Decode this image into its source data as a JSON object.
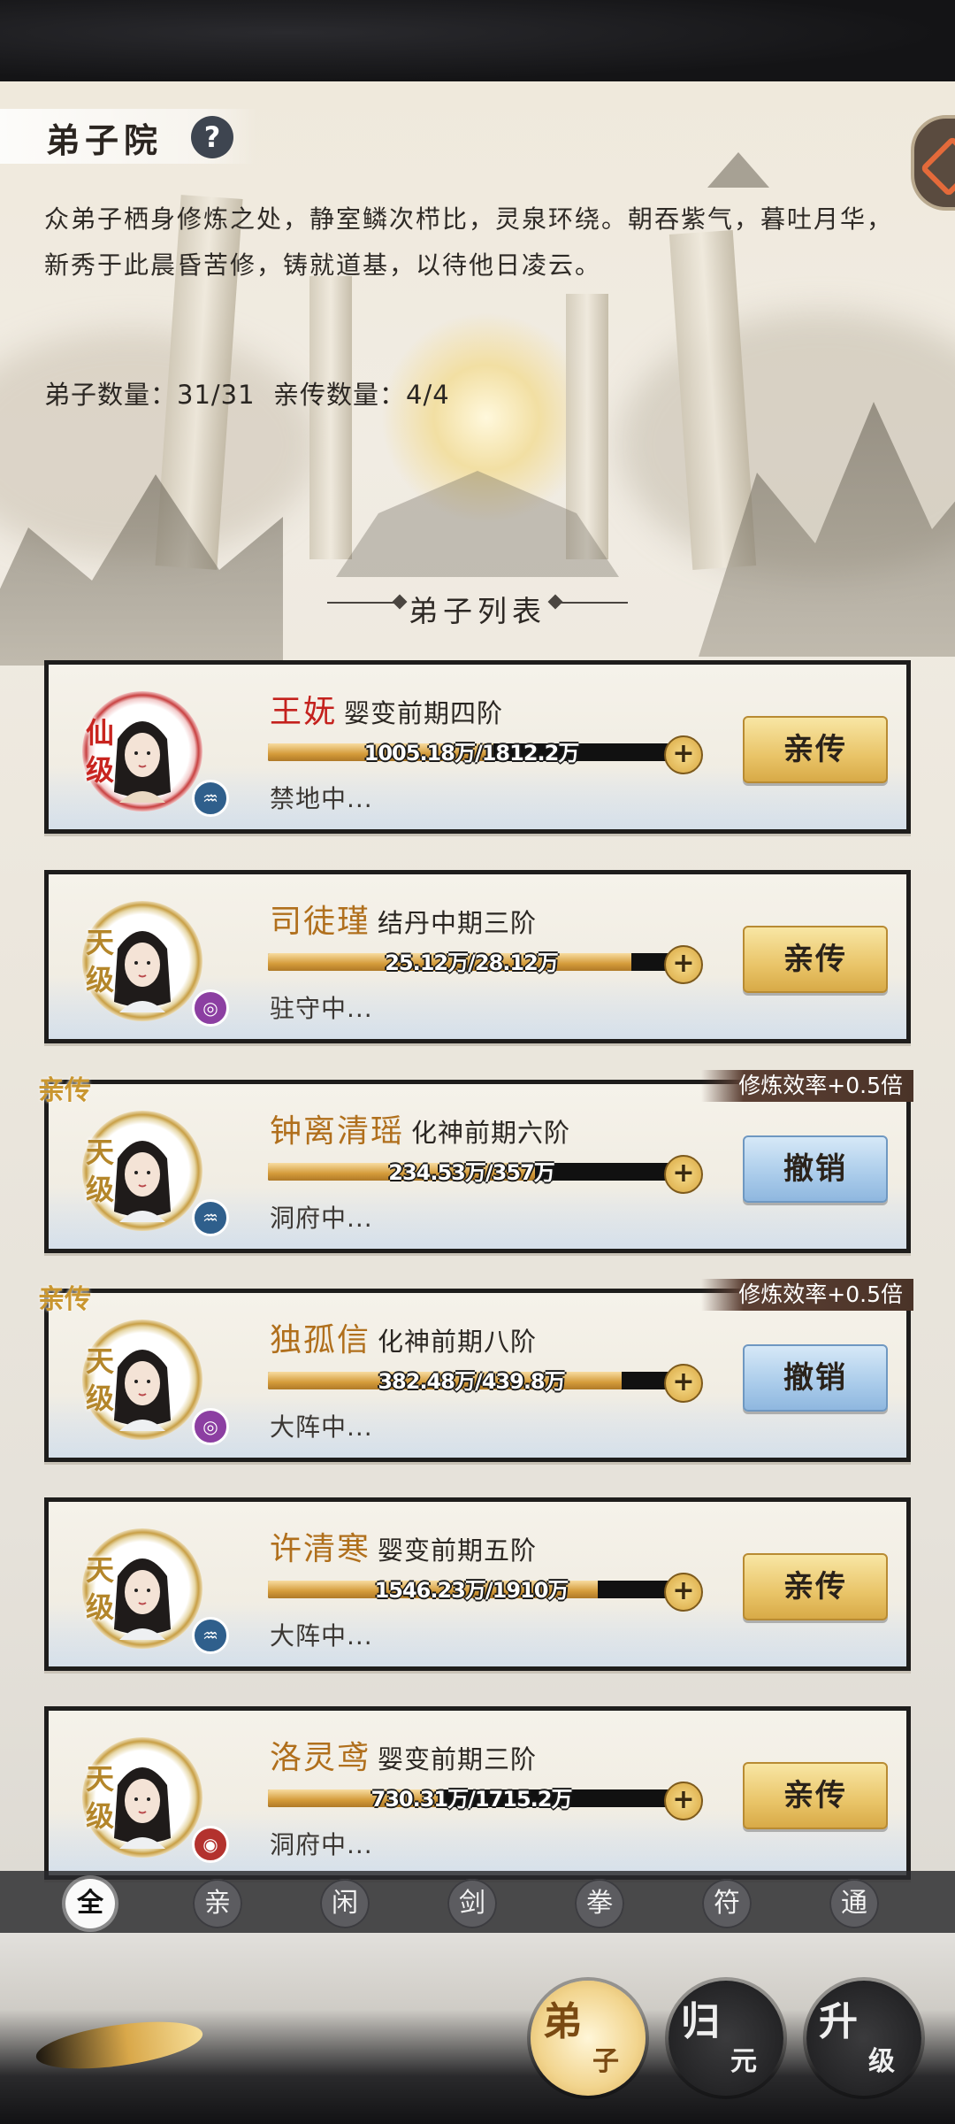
{
  "header": {
    "title": "弟子院",
    "help_label": "?",
    "description": "众弟子栖身修炼之处，静室鳞次栉比，灵泉环绕。朝吞紫气，暮吐月华，新秀于此晨昏苦修，铸就道基，以待他日凌云。",
    "stats": "弟子数量：31/31  亲传数量：4/4"
  },
  "section_title": "弟子列表",
  "disciples": [
    {
      "grade": "仙级",
      "name": "王妩",
      "realm": "婴变前期四阶",
      "progress_text": "1005.18万/1812.2万",
      "progress": 0.555,
      "location": "禁地中...",
      "action": "亲传",
      "is_personal": false,
      "bonus": "",
      "element_icon": "water-icon"
    },
    {
      "grade": "天级",
      "name": "司徒瑾",
      "realm": "结丹中期三阶",
      "progress_text": "25.12万/28.12万",
      "progress": 0.893,
      "location": "驻守中...",
      "action": "亲传",
      "is_personal": false,
      "bonus": "",
      "element_icon": "wind-icon"
    },
    {
      "grade": "天级",
      "name": "钟离清瑶",
      "realm": "化神前期六阶",
      "progress_text": "234.53万/357万",
      "progress": 0.657,
      "location": "洞府中...",
      "action": "撤销",
      "is_personal": true,
      "personal_label": "亲传",
      "bonus": "修炼效率+0.5倍",
      "element_icon": "water-icon"
    },
    {
      "grade": "天级",
      "name": "独孤信",
      "realm": "化神前期八阶",
      "progress_text": "382.48万/439.8万",
      "progress": 0.87,
      "location": "大阵中...",
      "action": "撤销",
      "is_personal": true,
      "personal_label": "亲传",
      "bonus": "修炼效率+0.5倍",
      "element_icon": "wind-icon"
    },
    {
      "grade": "天级",
      "name": "许清寒",
      "realm": "婴变前期五阶",
      "progress_text": "1546.23万/1910万",
      "progress": 0.81,
      "location": "大阵中...",
      "action": "亲传",
      "is_personal": false,
      "bonus": "",
      "element_icon": "water-icon"
    },
    {
      "grade": "天级",
      "name": "洛灵鸢",
      "realm": "婴变前期三阶",
      "progress_text": "730.31万/1715.2万",
      "progress": 0.426,
      "location": "洞府中...",
      "action": "亲传",
      "is_personal": false,
      "bonus": "",
      "element_icon": "fire-icon"
    }
  ],
  "filters": [
    "全",
    "亲",
    "闲",
    "剑",
    "拳",
    "符",
    "通"
  ],
  "active_filter": "全",
  "bottom_nav": [
    {
      "main": "弟",
      "sub": "子",
      "active": true
    },
    {
      "main": "归",
      "sub": "元",
      "active": false
    },
    {
      "main": "升",
      "sub": "级",
      "active": false
    }
  ],
  "colors": {
    "name_gold": "#b06f1c",
    "name_red": "#c4211d",
    "action_gold": "#e9c468",
    "action_blue": "#a9cbea",
    "bonus_bg": "#4a3328"
  }
}
